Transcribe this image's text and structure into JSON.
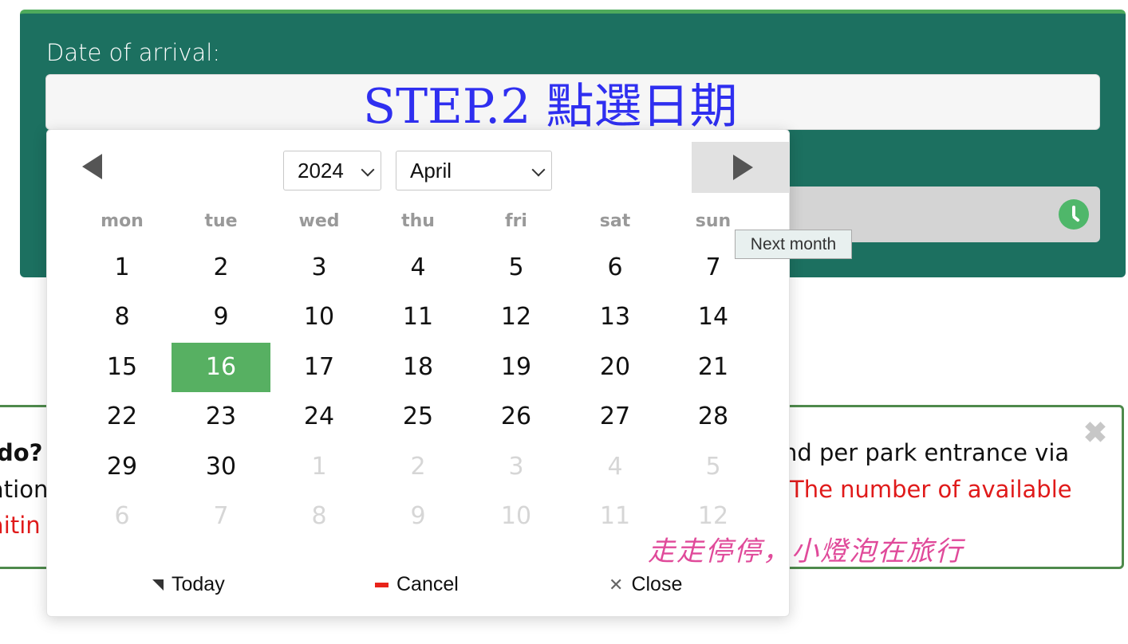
{
  "form": {
    "date_label": "Date of arrival:",
    "date_value": "",
    "annotation": "STEP.2 點選日期"
  },
  "info_card": {
    "left_lines": [
      " do?",
      "ation",
      "aitin"
    ],
    "right_lines": [
      "nd per park entrance via",
      ": The number of available"
    ]
  },
  "calendar": {
    "year": "2024",
    "month": "April",
    "weekdays": [
      "mon",
      "tue",
      "wed",
      "thu",
      "fri",
      "sat",
      "sun"
    ],
    "weeks": [
      [
        "1",
        "2",
        "3",
        "4",
        "5",
        "6",
        "7"
      ],
      [
        "8",
        "9",
        "10",
        "11",
        "12",
        "13",
        "14"
      ],
      [
        "15",
        "16",
        "17",
        "18",
        "19",
        "20",
        "21"
      ],
      [
        "22",
        "23",
        "24",
        "25",
        "26",
        "27",
        "28"
      ],
      [
        "29",
        "30",
        "1",
        "2",
        "3",
        "4",
        "5"
      ],
      [
        "6",
        "7",
        "8",
        "9",
        "10",
        "11",
        "12"
      ]
    ],
    "selected": "16",
    "tooltip": "Next month",
    "buttons": {
      "today": "Today",
      "cancel": "Cancel",
      "close": "Close"
    }
  },
  "watermark": "走走停停，小燈泡在旅行",
  "colors": {
    "panel": "#1c7060",
    "selected_day": "#57b062",
    "annotation": "#2f2ff0",
    "alert": "#e01a1a"
  }
}
